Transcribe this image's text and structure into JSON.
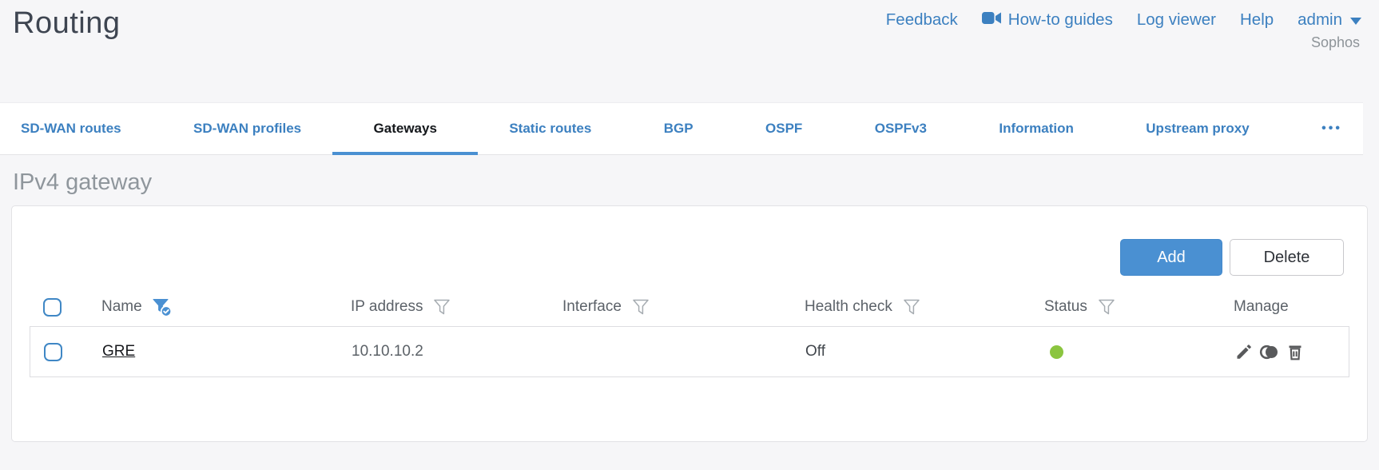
{
  "page": {
    "title": "Routing"
  },
  "utility_nav": {
    "feedback": "Feedback",
    "howto_guides": "How-to guides",
    "log_viewer": "Log viewer",
    "help": "Help",
    "user": "admin",
    "brand": "Sophos"
  },
  "tabs": {
    "items": [
      {
        "label": "SD-WAN routes",
        "active": false
      },
      {
        "label": "SD-WAN profiles",
        "active": false
      },
      {
        "label": "Gateways",
        "active": true
      },
      {
        "label": "Static routes",
        "active": false
      },
      {
        "label": "BGP",
        "active": false
      },
      {
        "label": "OSPF",
        "active": false
      },
      {
        "label": "OSPFv3",
        "active": false
      },
      {
        "label": "Information",
        "active": false
      },
      {
        "label": "Upstream proxy",
        "active": false
      }
    ],
    "overflow": "•••"
  },
  "section": {
    "heading": "IPv4 gateway"
  },
  "toolbar": {
    "add_label": "Add",
    "delete_label": "Delete"
  },
  "table": {
    "columns": [
      {
        "label": "Name",
        "filter": "active"
      },
      {
        "label": "IP address",
        "filter": "default"
      },
      {
        "label": "Interface",
        "filter": "default"
      },
      {
        "label": "Health check",
        "filter": "default"
      },
      {
        "label": "Status",
        "filter": "default"
      },
      {
        "label": "Manage",
        "filter": "none"
      }
    ],
    "rows": [
      {
        "name": "GRE",
        "ip_address": "10.10.10.2",
        "interface": "",
        "health_check": "Off",
        "status": "connected"
      }
    ]
  },
  "colors": {
    "accent_blue": "#4a90d2",
    "link_blue": "#3c80c0",
    "status_green": "#8bc53f",
    "active_tab_text": "#15181c",
    "heading_gray": "#8f969c"
  }
}
